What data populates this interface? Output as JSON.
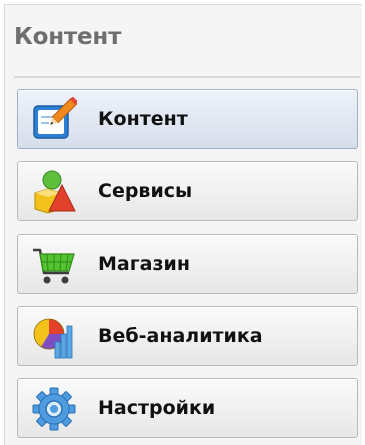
{
  "panel": {
    "title": "Контент"
  },
  "menu": {
    "items": [
      {
        "label": "Контент",
        "icon": "pencil-icon",
        "active": true
      },
      {
        "label": "Сервисы",
        "icon": "shapes-icon",
        "active": false
      },
      {
        "label": "Магазин",
        "icon": "shopping-cart-icon",
        "active": false
      },
      {
        "label": "Веб-аналитика",
        "icon": "pie-chart-icon",
        "active": false
      },
      {
        "label": "Настройки",
        "icon": "gear-icon",
        "active": false
      }
    ]
  }
}
